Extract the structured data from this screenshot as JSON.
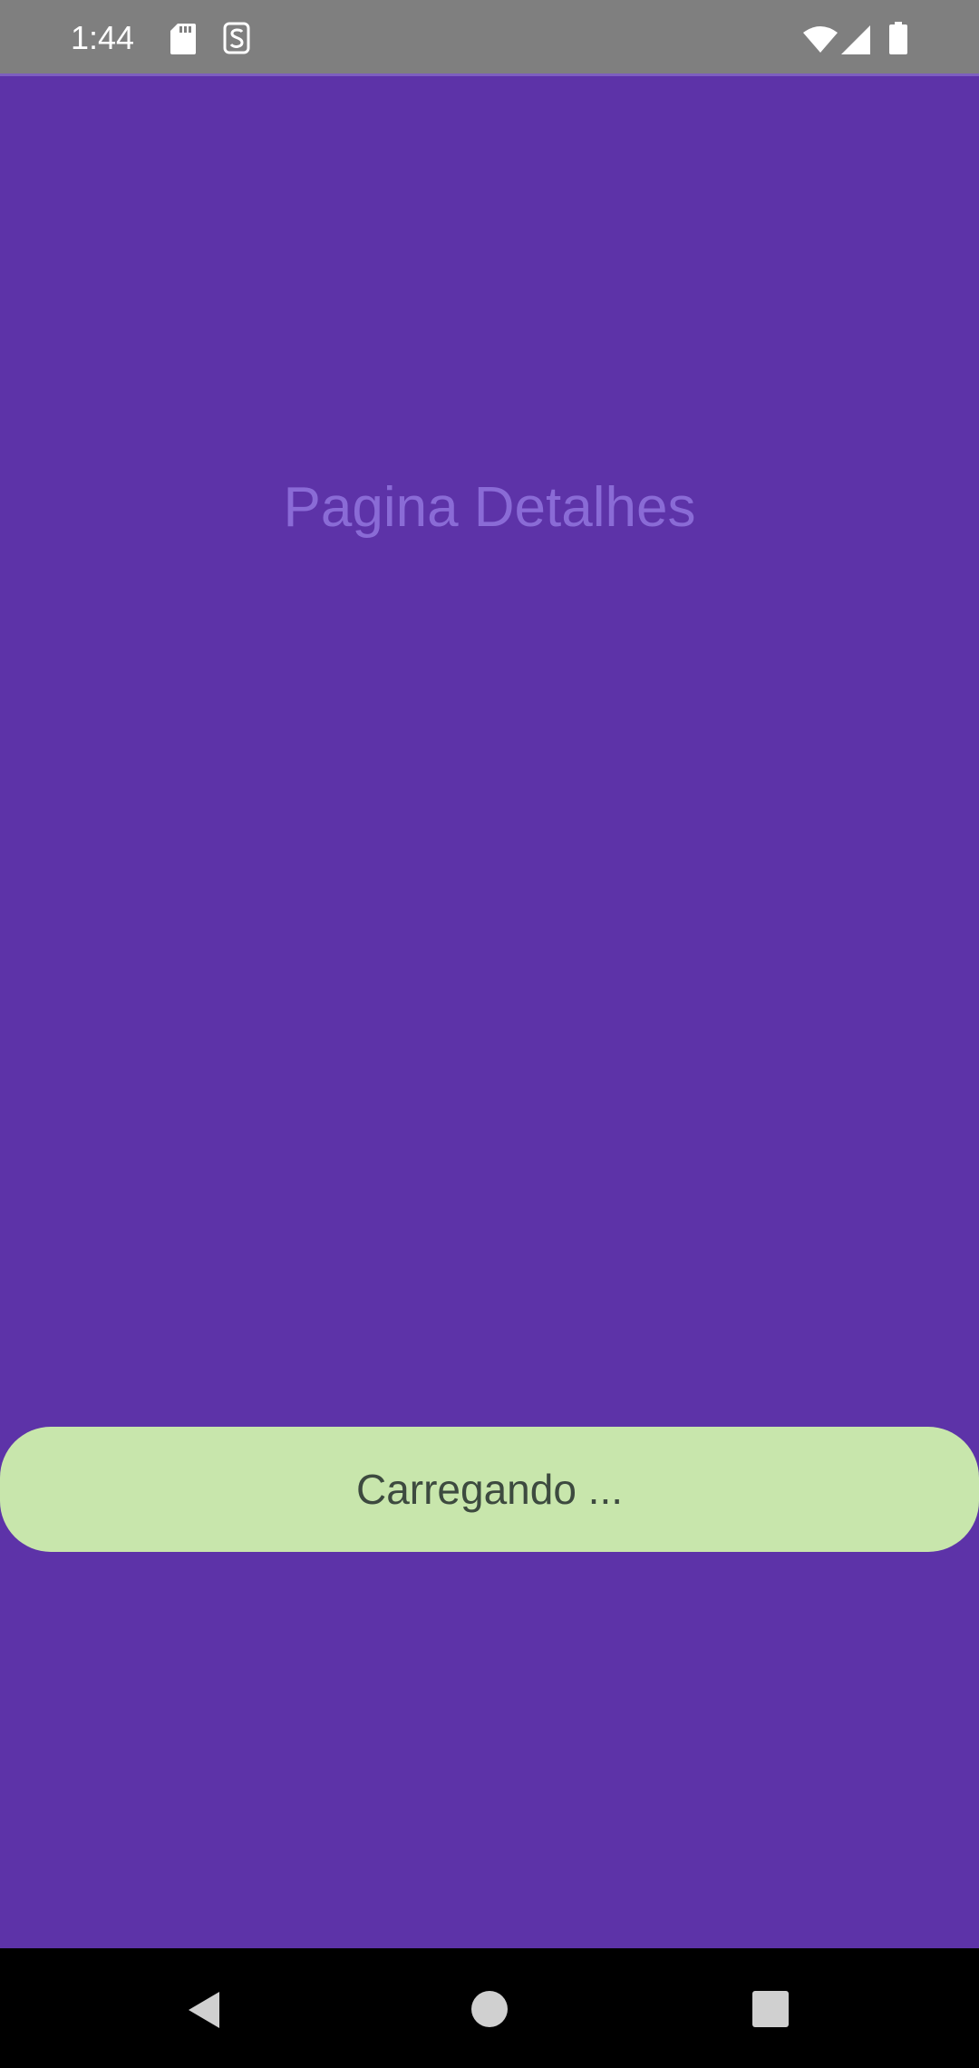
{
  "status_bar": {
    "time": "1:44",
    "icons": [
      "sd-card-icon",
      "s-notification-icon",
      "wifi-icon",
      "cell-signal-icon",
      "battery-icon"
    ]
  },
  "page": {
    "title": "Pagina Detalhes",
    "background_color": "#5d33a8",
    "title_color": "#8a6bd6"
  },
  "snackbar": {
    "message": "Carregando ...",
    "background_color": "#c8e6ac"
  },
  "nav_bar": {
    "icons": [
      "back-icon",
      "home-icon",
      "recents-icon"
    ]
  }
}
